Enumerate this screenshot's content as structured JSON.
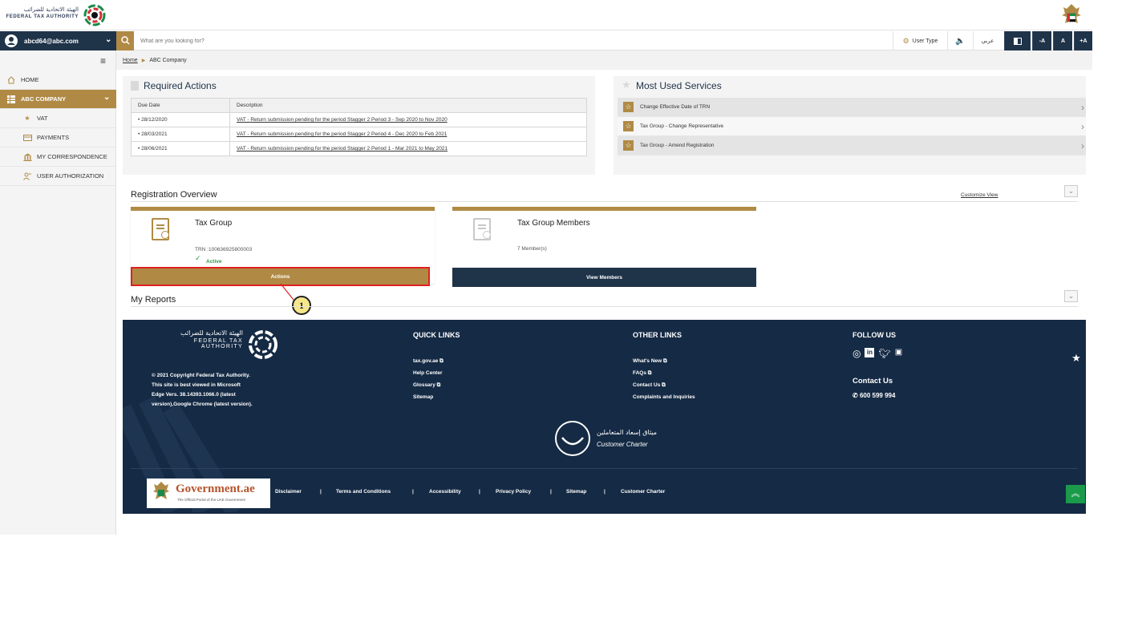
{
  "header": {
    "logo_arabic": "الهيئة الاتحادية للضرائب",
    "logo_english": "FEDERAL TAX AUTHORITY"
  },
  "user": {
    "email": "abcd64@abc.com"
  },
  "search": {
    "placeholder": "What are you looking for?"
  },
  "toolbar": {
    "user_type": "User Type",
    "arabic": "عربي",
    "font_decrease": "-A",
    "font_normal": "A",
    "font_increase": "+A"
  },
  "breadcrumb": {
    "home": "Home",
    "current": "ABC Company"
  },
  "sidebar": {
    "items": [
      {
        "label": "HOME",
        "icon": "home-icon"
      },
      {
        "label": "ABC COMPANY",
        "icon": "grid-icon"
      },
      {
        "label": "VAT",
        "icon": "vat-icon"
      },
      {
        "label": "PAYMENTS",
        "icon": "payments-icon"
      },
      {
        "label": "MY CORRESPONDENCE",
        "icon": "bank-icon"
      },
      {
        "label": "USER AUTHORIZATION",
        "icon": "user-key-icon"
      }
    ]
  },
  "required_actions": {
    "title": "Required Actions",
    "headers": [
      "Due Date",
      "Description"
    ],
    "rows": [
      {
        "date": "• 28/12/2020",
        "desc": "VAT - Return submission pending for the period Stagger 2 Period 3 - Sep 2020 to Nov 2020"
      },
      {
        "date": "• 28/03/2021",
        "desc": "VAT - Return submission pending for the period Stagger 2 Period 4 - Dec 2020 to Feb 2021"
      },
      {
        "date": "• 28/06/2021",
        "desc": "VAT - Return submission pending for the period Stagger 2 Period 1 - Mar 2021 to May 2021"
      }
    ]
  },
  "most_used": {
    "title": "Most Used Services",
    "items": [
      "Change Effective Date of TRN",
      "Tax Group - Change Representative",
      "Tax Group - Amend Registration"
    ]
  },
  "registration": {
    "title": "Registration Overview",
    "customize": "Customize View",
    "card1": {
      "title": "Tax Group",
      "trn": "TRN :100636925800003",
      "status": "Active",
      "button": "Actions"
    },
    "card2": {
      "title": "Tax Group Members",
      "members": "7 Member(s)",
      "button": "View Members"
    }
  },
  "annotation": {
    "number": "1"
  },
  "reports": {
    "title": "My Reports"
  },
  "footer": {
    "logo_arabic": "الهيئة الاتحادية للضرائب",
    "logo_english": "FEDERAL TAX AUTHORITY",
    "copyright": "© 2021 Copyright Federal Tax Authority.",
    "browser1": "This site is best viewed in Microsoft",
    "browser2": "Edge Vers. 38.14393.1066.0 (latest",
    "browser3": "version),Google Chrome (latest version).",
    "quick_links_title": "QUICK LINKS",
    "quick_links": [
      "tax.gov.ae",
      "Help Center",
      "Glossary",
      "Sitemap"
    ],
    "other_links_title": "OTHER LINKS",
    "other_links": [
      "What's New",
      "FAQs",
      "Contact Us",
      "Complaints and Inquiries"
    ],
    "follow_title": "FOLLOW US",
    "contact_title": "Contact Us",
    "phone": "600 599 994",
    "charter_arabic": "ميثاق إسعاد المتعاملين",
    "charter_english": "Customer Charter",
    "gov_logo": "Government.ae",
    "gov_sub": "The Official Portal of the UAE Government",
    "bottom_links": [
      "Disclaimer",
      "Terms and Conditions",
      "Accessibility",
      "Privacy Policy",
      "Sitemap",
      "Customer Charter"
    ]
  },
  "colors": {
    "gold": "#b08a45",
    "navy": "#1f3349",
    "footer": "#152a44",
    "annotation": "#e02020"
  }
}
